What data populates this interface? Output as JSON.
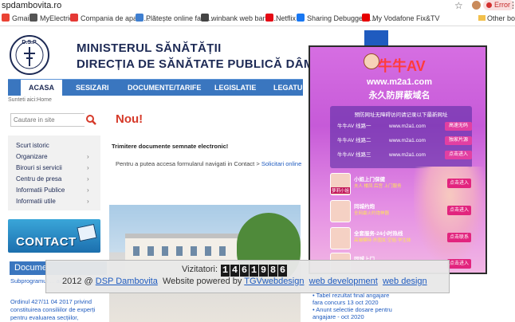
{
  "browser": {
    "url": "spdambovita.ro",
    "profile_status": "Error",
    "bookmarks": [
      {
        "label": "Gmail",
        "color": "#ea4335"
      },
      {
        "label": "MyElectrica",
        "color": "#555555"
      },
      {
        "label": "Compania de apa B...",
        "color": "#e53935"
      },
      {
        "label": "Plătește online fact...",
        "color": "#3f7fd0"
      },
      {
        "label": "winbank web banki...",
        "color": "#444444"
      },
      {
        "label": "Netflix",
        "color": "#e50914"
      },
      {
        "label": "Sharing Debugger -...",
        "color": "#1877f2"
      },
      {
        "label": "My Vodafone Fix&TV",
        "color": "#e60000"
      }
    ],
    "other_bookmarks": "Other book"
  },
  "site": {
    "logo_text": "D.S.P.",
    "title_line1": "MINISTERUL SĂNĂTĂȚII",
    "title_line2": "DIRECȚIA DE SĂNĂTATE PUBLICĂ DÂMBOVITA",
    "nav": [
      "ACASA",
      "SESIZARI",
      "DOCUMENTE/TARIFE",
      "LEGISLATIE",
      "LEGATURI U"
    ],
    "breadcrumb": "Sunteti aici:Home",
    "search_placeholder": "Cautare in site",
    "left_menu": [
      "Scurt istoric",
      "Organizare",
      "Birouri si servicii",
      "Centru de presa",
      "Informatii Publice",
      "Informatii utile"
    ],
    "contact_label": "CONTACT",
    "documents_heading": "Docume",
    "news": [
      "Subprogramul ... activa a cancer",
      "Ordinul 427/11 04 2017 privind constituirea consiliilor de experți pentru evaluarea secțiilor,"
    ],
    "new_heading": "Nou!",
    "notice_title": "Trimitere documente semnate electronic!",
    "notice_text": "Pentru a putea accesa formularul navigati in Contact >",
    "notice_link": "Solicitari online",
    "right_news": [
      "Tabel rezultat final angajare fara concurs 13 oct 2020",
      "Anunt selectie dosare pentru angajare - oct 2020"
    ]
  },
  "ad": {
    "brand": "牛牛AV",
    "url": "www.m2a1.com",
    "slogan": "永久防屏蔽域名",
    "box_title": "预防网址无障碍访问请记录以下最新网址",
    "rows": [
      {
        "name": "牛牛AV 线路一",
        "url": "www.m2a1.com",
        "button": "高速无码"
      },
      {
        "name": "牛牛AV 线路二",
        "url": "www.m2a1.com",
        "button": "独家片源"
      },
      {
        "name": "牛牛AV 线路三",
        "url": "www.m2a1.com",
        "button": "点击进入"
      }
    ],
    "items": [
      {
        "title": "小姐上门保健",
        "subtitle": "夫人 楼凤 后宫 上门服务",
        "button": "点击进入",
        "thumb_caption": "萝莉小姐"
      },
      {
        "title": "同城约炮",
        "subtitle": "全网最火约炮神器",
        "button": "点击进入",
        "thumb_caption": ""
      },
      {
        "title": "全套服务-24小时热线",
        "subtitle": "高端模特·外围女·空姐·学生妹",
        "button": "点击联系",
        "thumb_caption": ""
      },
      {
        "title": "同城上门",
        "subtitle": "",
        "button": "点击进入",
        "thumb_caption": ""
      }
    ]
  },
  "footer": {
    "visitors_label": "Vizitatori:",
    "visitors_count": "1461986",
    "year_text": "2012 @",
    "site_link": "DSP Dambovita",
    "powered_text": "Website powered by",
    "links": [
      "TGVwebdesign",
      "web development",
      "web design"
    ]
  },
  "colors": {
    "nav_blue": "#3a76bf",
    "title_navy": "#1d2a55",
    "accent_red": "#d63a2a",
    "link_blue": "#1f5bbf",
    "ad_magenta": "#c65ad8"
  }
}
